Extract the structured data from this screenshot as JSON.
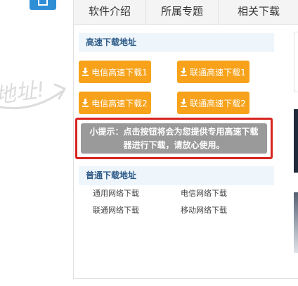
{
  "tabs": [
    {
      "label": "软件介绍"
    },
    {
      "label": "所属专题"
    },
    {
      "label": "相关下载"
    }
  ],
  "high_speed": {
    "title": "高速下载地址",
    "buttons": [
      {
        "label": "电信高速下载1"
      },
      {
        "label": "联通高速下载1"
      },
      {
        "label": "电信高速下载2"
      },
      {
        "label": "联通高速下载2"
      }
    ]
  },
  "tip": {
    "line1": "小提示：点击按钮将会为您提供专用高速下载",
    "line2": "器进行下载，请放心使用。"
  },
  "normal": {
    "title": "普通下载地址",
    "links": [
      {
        "label": "通用网络下载"
      },
      {
        "label": "电信网络下载"
      },
      {
        "label": "联通网络下载"
      },
      {
        "label": "移动网络下载"
      }
    ]
  },
  "decoration": {
    "handwritten_text": "地址!"
  },
  "colors": {
    "accent_orange": "#f7a21a",
    "tip_border_red": "#d8241f",
    "tip_bg_gray": "#9a9a9a",
    "section_title_blue": "#2e5b87",
    "section_bg": "#eef6fc",
    "top_button_blue": "#2e8fd6"
  },
  "icons": {
    "download": "download-icon"
  }
}
